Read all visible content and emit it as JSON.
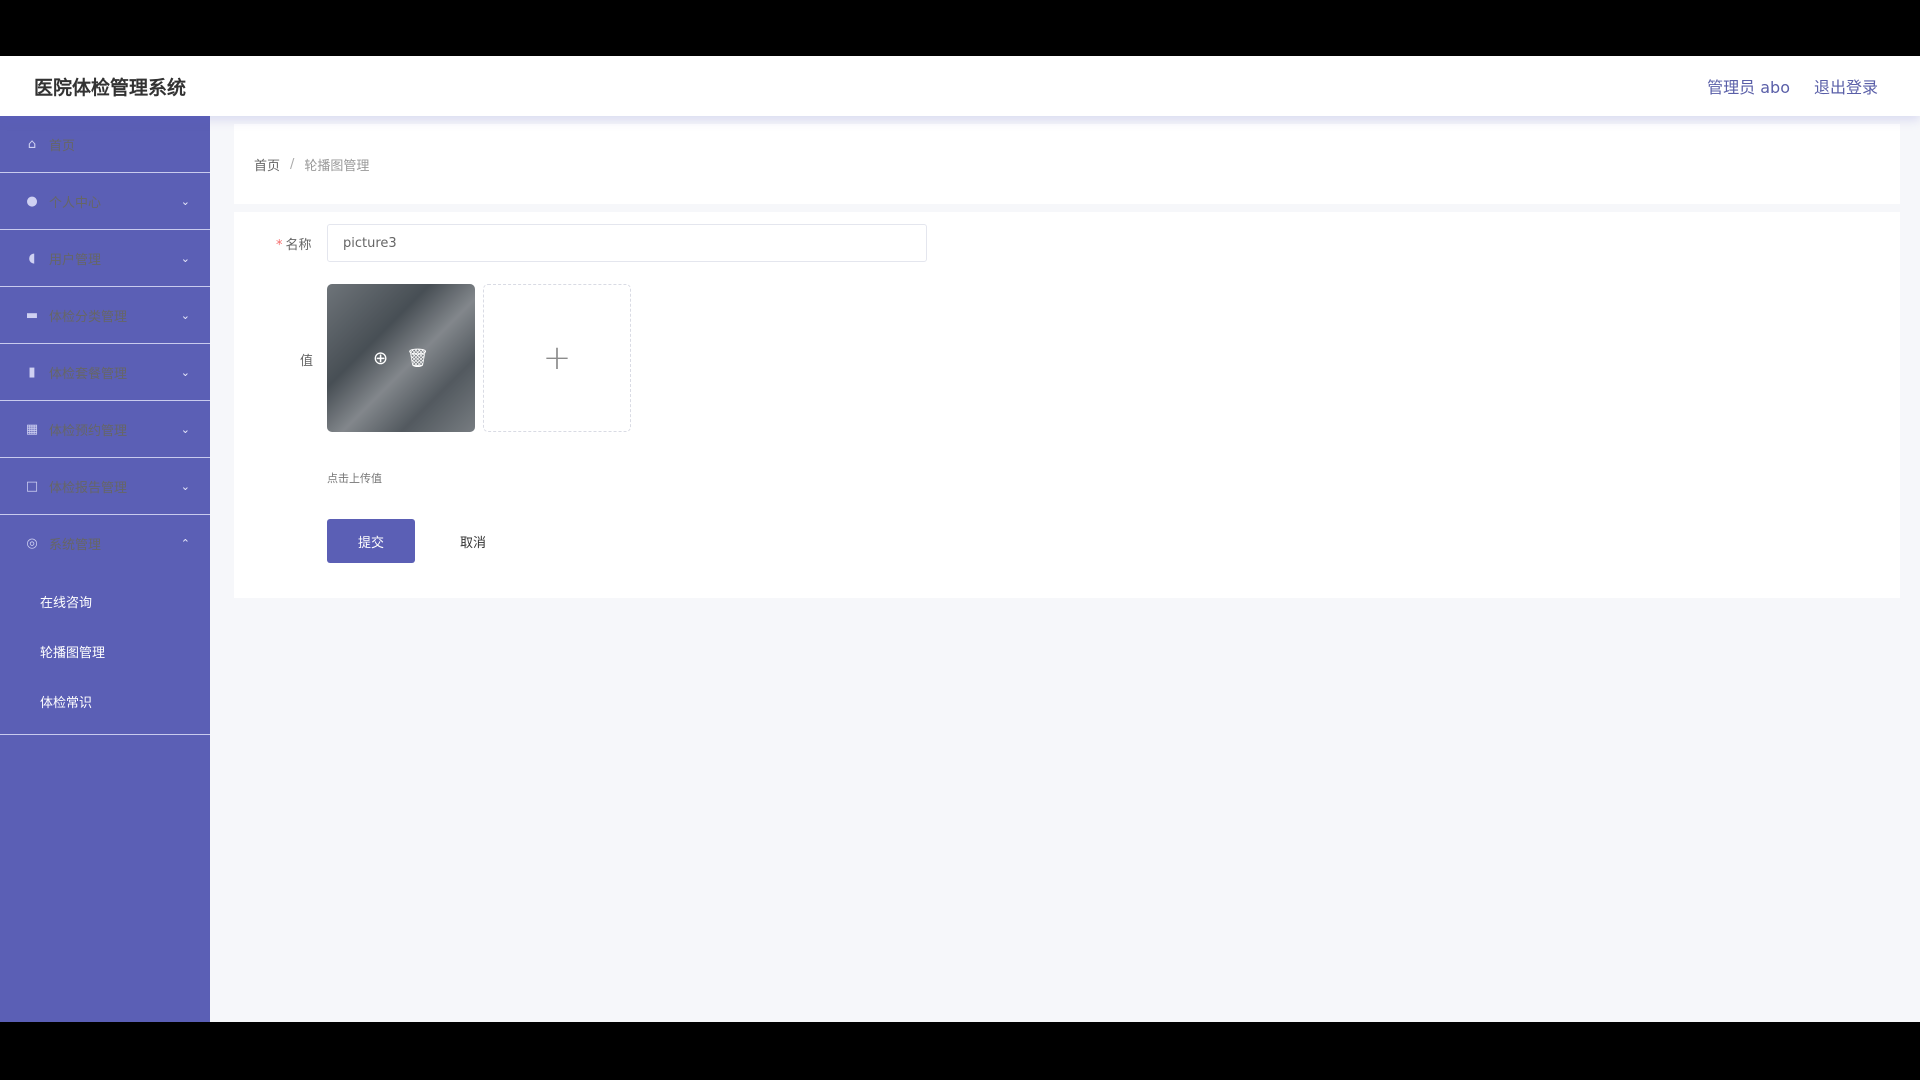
{
  "header": {
    "title": "医院体检管理系统",
    "user": "管理员 abo",
    "logout": "退出登录"
  },
  "sidebar": {
    "items": [
      {
        "label": "首页",
        "icon": "home-icon"
      },
      {
        "label": "个人中心",
        "icon": "user-icon"
      },
      {
        "label": "用户管理",
        "icon": "microphone-icon"
      },
      {
        "label": "体检分类管理",
        "icon": "folder-icon"
      },
      {
        "label": "体检套餐管理",
        "icon": "bar-chart-icon"
      },
      {
        "label": "体检预约管理",
        "icon": "grid-icon"
      },
      {
        "label": "体检报告管理",
        "icon": "crop-icon"
      },
      {
        "label": "系统管理",
        "icon": "compass-icon"
      }
    ],
    "subitems": [
      "在线咨询",
      "轮播图管理",
      "体检常识"
    ]
  },
  "breadcrumb": {
    "home": "首页",
    "separator": "/",
    "current": "轮播图管理"
  },
  "form": {
    "name_label": "名称",
    "required_mark": "*",
    "name_value": "picture3",
    "value_label": "值",
    "upload_hint": "点击上传值",
    "submit": "提交",
    "cancel": "取消"
  },
  "colors": {
    "accent": "#5b5fb5",
    "background": "#f6f7fa"
  }
}
